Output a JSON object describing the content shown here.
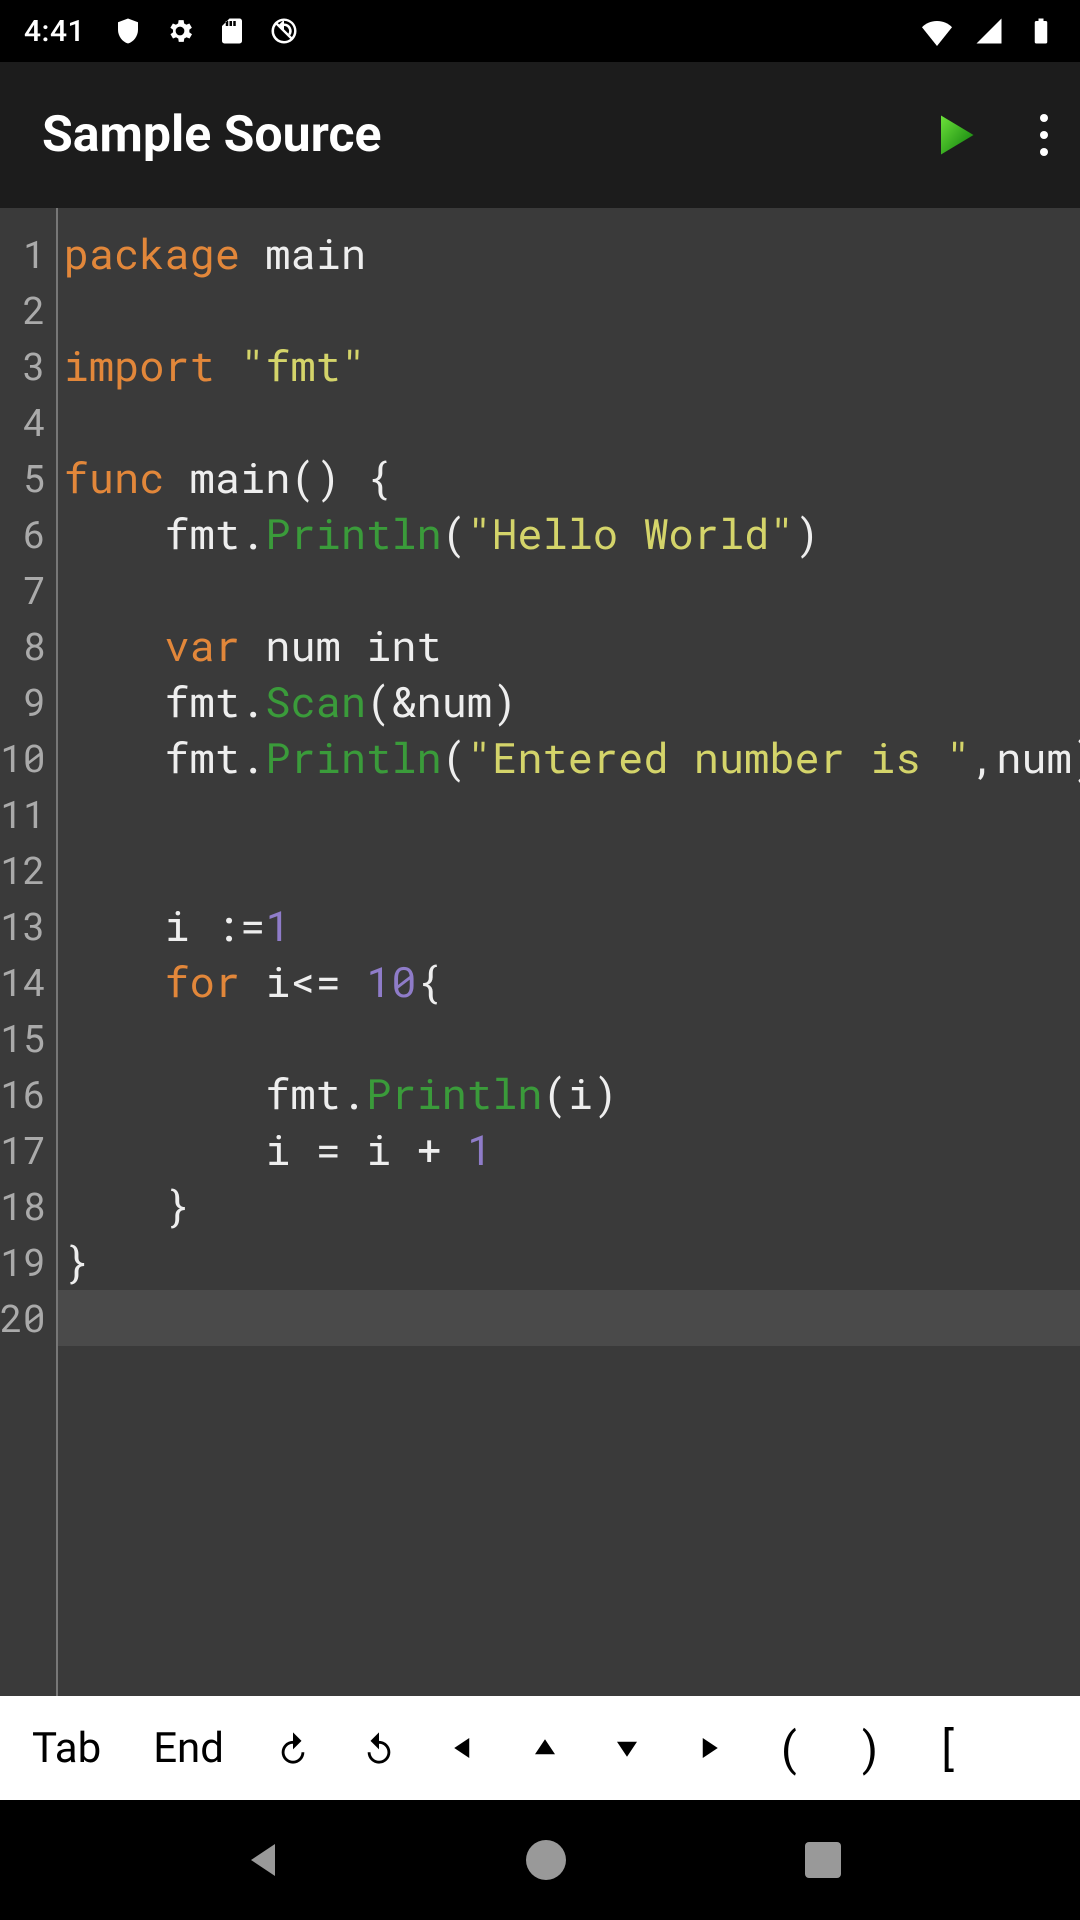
{
  "status": {
    "time": "4:41"
  },
  "app": {
    "title": "Sample Source"
  },
  "editor": {
    "line_numbers": [
      "1",
      "2",
      "3",
      "4",
      "5",
      "6",
      "7",
      "8",
      "9",
      "10",
      "11",
      "12",
      "13",
      "14",
      "15",
      "16",
      "17",
      "18",
      "19",
      "20"
    ],
    "active_line_index": 19,
    "code_lines": [
      [
        {
          "c": "kw",
          "t": "package"
        },
        {
          "c": "pln",
          "t": " main"
        }
      ],
      [],
      [
        {
          "c": "kw",
          "t": "import"
        },
        {
          "c": "pln",
          "t": " "
        },
        {
          "c": "str",
          "t": "\"fmt\""
        }
      ],
      [],
      [
        {
          "c": "kw",
          "t": "func"
        },
        {
          "c": "pln",
          "t": " main() {"
        }
      ],
      [
        {
          "c": "pln",
          "t": "    fmt."
        },
        {
          "c": "fn",
          "t": "Println"
        },
        {
          "c": "pln",
          "t": "("
        },
        {
          "c": "str",
          "t": "\"Hello World\""
        },
        {
          "c": "pln",
          "t": ")"
        }
      ],
      [],
      [
        {
          "c": "pln",
          "t": "    "
        },
        {
          "c": "kw",
          "t": "var"
        },
        {
          "c": "pln",
          "t": " num int"
        }
      ],
      [
        {
          "c": "pln",
          "t": "    fmt."
        },
        {
          "c": "fn",
          "t": "Scan"
        },
        {
          "c": "pln",
          "t": "(&num)"
        }
      ],
      [
        {
          "c": "pln",
          "t": "    fmt."
        },
        {
          "c": "fn",
          "t": "Println"
        },
        {
          "c": "pln",
          "t": "("
        },
        {
          "c": "str",
          "t": "\"Entered number is \""
        },
        {
          "c": "pln",
          "t": ",num)"
        }
      ],
      [],
      [],
      [
        {
          "c": "pln",
          "t": "    i :="
        },
        {
          "c": "num",
          "t": "1"
        }
      ],
      [
        {
          "c": "pln",
          "t": "    "
        },
        {
          "c": "kw",
          "t": "for"
        },
        {
          "c": "pln",
          "t": " i<= "
        },
        {
          "c": "num",
          "t": "10"
        },
        {
          "c": "pln",
          "t": "{"
        }
      ],
      [],
      [
        {
          "c": "pln",
          "t": "        fmt."
        },
        {
          "c": "fn",
          "t": "Println"
        },
        {
          "c": "pln",
          "t": "(i)"
        }
      ],
      [
        {
          "c": "pln",
          "t": "        i = i + "
        },
        {
          "c": "num",
          "t": "1"
        }
      ],
      [
        {
          "c": "pln",
          "t": "    }"
        }
      ],
      [
        {
          "c": "pln",
          "t": "}"
        }
      ],
      []
    ]
  },
  "keyrow": {
    "tab": "Tab",
    "end": "End",
    "lparen": "(",
    "rparen": ")",
    "lbracket": "["
  }
}
